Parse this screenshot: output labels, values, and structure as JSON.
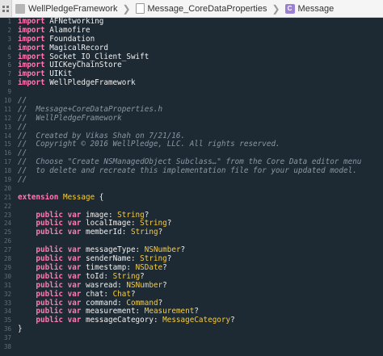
{
  "jumpbar": {
    "items": [
      {
        "label": "WellPledgeFramework",
        "icon": "folder-icon"
      },
      {
        "label": "Message_CoreDataProperties",
        "icon": "swift-file-icon"
      },
      {
        "label": "Message",
        "icon": "class-icon"
      }
    ],
    "class_icon_letter": "C",
    "separator": "❯"
  },
  "colors": {
    "background": "#1e2a33",
    "keyword": "#ff7ab2",
    "comment": "#8a97a3",
    "type": "#f5cc41",
    "plain": "#f0f0f0",
    "line_number": "#5f6e78"
  },
  "code": [
    {
      "n": "1",
      "tokens": [
        {
          "t": "kw",
          "v": "import"
        },
        {
          "t": "plain",
          "v": " AFNetworking"
        }
      ]
    },
    {
      "n": "2",
      "tokens": [
        {
          "t": "kw",
          "v": "import"
        },
        {
          "t": "plain",
          "v": " Alamofire"
        }
      ]
    },
    {
      "n": "3",
      "tokens": [
        {
          "t": "kw",
          "v": "import"
        },
        {
          "t": "plain",
          "v": " Foundation"
        }
      ]
    },
    {
      "n": "4",
      "tokens": [
        {
          "t": "kw",
          "v": "import"
        },
        {
          "t": "plain",
          "v": " MagicalRecord"
        }
      ]
    },
    {
      "n": "5",
      "tokens": [
        {
          "t": "kw",
          "v": "import"
        },
        {
          "t": "plain",
          "v": " Socket_IO_Client_Swift"
        }
      ]
    },
    {
      "n": "6",
      "tokens": [
        {
          "t": "kw",
          "v": "import"
        },
        {
          "t": "plain",
          "v": " UICKeyChainStore"
        }
      ]
    },
    {
      "n": "7",
      "tokens": [
        {
          "t": "kw",
          "v": "import"
        },
        {
          "t": "plain",
          "v": " UIKit"
        }
      ]
    },
    {
      "n": "8",
      "tokens": [
        {
          "t": "kw",
          "v": "import"
        },
        {
          "t": "plain",
          "v": " WellPledgeFramework"
        }
      ]
    },
    {
      "n": "9",
      "tokens": []
    },
    {
      "n": "10",
      "tokens": [
        {
          "t": "cm",
          "v": "//"
        }
      ]
    },
    {
      "n": "11",
      "tokens": [
        {
          "t": "cm",
          "v": "//  Message+CoreDataProperties.h"
        }
      ]
    },
    {
      "n": "12",
      "tokens": [
        {
          "t": "cm",
          "v": "//  WellPledgeFramework"
        }
      ]
    },
    {
      "n": "13",
      "tokens": [
        {
          "t": "cm",
          "v": "//"
        }
      ]
    },
    {
      "n": "14",
      "tokens": [
        {
          "t": "cm",
          "v": "//  Created by Vikas Shah on 7/21/16."
        }
      ]
    },
    {
      "n": "15",
      "tokens": [
        {
          "t": "cm",
          "v": "//  Copyright © 2016 WellPledge, LLC. All rights reserved."
        }
      ]
    },
    {
      "n": "16",
      "tokens": [
        {
          "t": "cm",
          "v": "//"
        }
      ]
    },
    {
      "n": "17",
      "tokens": [
        {
          "t": "cm",
          "v": "//  Choose \"Create NSManagedObject Subclass…\" from the Core Data editor menu"
        }
      ]
    },
    {
      "n": "18",
      "tokens": [
        {
          "t": "cm",
          "v": "//  to delete and recreate this implementation file for your updated model."
        }
      ]
    },
    {
      "n": "19",
      "tokens": [
        {
          "t": "cm",
          "v": "//"
        }
      ]
    },
    {
      "n": "20",
      "tokens": []
    },
    {
      "n": "21",
      "tokens": [
        {
          "t": "kw",
          "v": "extension"
        },
        {
          "t": "plain",
          "v": " "
        },
        {
          "t": "ty",
          "v": "Message"
        },
        {
          "t": "plain",
          "v": " {"
        }
      ]
    },
    {
      "n": "22",
      "tokens": []
    },
    {
      "n": "23",
      "tokens": [
        {
          "t": "plain",
          "v": "    "
        },
        {
          "t": "kw",
          "v": "public"
        },
        {
          "t": "plain",
          "v": " "
        },
        {
          "t": "kw",
          "v": "var"
        },
        {
          "t": "plain",
          "v": " image: "
        },
        {
          "t": "ty",
          "v": "String"
        },
        {
          "t": "plain",
          "v": "?"
        }
      ]
    },
    {
      "n": "24",
      "tokens": [
        {
          "t": "plain",
          "v": "    "
        },
        {
          "t": "kw",
          "v": "public"
        },
        {
          "t": "plain",
          "v": " "
        },
        {
          "t": "kw",
          "v": "var"
        },
        {
          "t": "plain",
          "v": " localImage: "
        },
        {
          "t": "ty",
          "v": "String"
        },
        {
          "t": "plain",
          "v": "?"
        }
      ]
    },
    {
      "n": "25",
      "tokens": [
        {
          "t": "plain",
          "v": "    "
        },
        {
          "t": "kw",
          "v": "public"
        },
        {
          "t": "plain",
          "v": " "
        },
        {
          "t": "kw",
          "v": "var"
        },
        {
          "t": "plain",
          "v": " memberId: "
        },
        {
          "t": "ty",
          "v": "String"
        },
        {
          "t": "plain",
          "v": "?"
        }
      ]
    },
    {
      "n": "26",
      "tokens": []
    },
    {
      "n": "27",
      "tokens": [
        {
          "t": "plain",
          "v": "    "
        },
        {
          "t": "kw",
          "v": "public"
        },
        {
          "t": "plain",
          "v": " "
        },
        {
          "t": "kw",
          "v": "var"
        },
        {
          "t": "plain",
          "v": " messageType: "
        },
        {
          "t": "ty",
          "v": "NSNumber"
        },
        {
          "t": "plain",
          "v": "?"
        }
      ]
    },
    {
      "n": "28",
      "tokens": [
        {
          "t": "plain",
          "v": "    "
        },
        {
          "t": "kw",
          "v": "public"
        },
        {
          "t": "plain",
          "v": " "
        },
        {
          "t": "kw",
          "v": "var"
        },
        {
          "t": "plain",
          "v": " senderName: "
        },
        {
          "t": "ty",
          "v": "String"
        },
        {
          "t": "plain",
          "v": "?"
        }
      ]
    },
    {
      "n": "29",
      "tokens": [
        {
          "t": "plain",
          "v": "    "
        },
        {
          "t": "kw",
          "v": "public"
        },
        {
          "t": "plain",
          "v": " "
        },
        {
          "t": "kw",
          "v": "var"
        },
        {
          "t": "plain",
          "v": " timestamp: "
        },
        {
          "t": "ty",
          "v": "NSDate"
        },
        {
          "t": "plain",
          "v": "?"
        }
      ]
    },
    {
      "n": "30",
      "tokens": [
        {
          "t": "plain",
          "v": "    "
        },
        {
          "t": "kw",
          "v": "public"
        },
        {
          "t": "plain",
          "v": " "
        },
        {
          "t": "kw",
          "v": "var"
        },
        {
          "t": "plain",
          "v": " toId: "
        },
        {
          "t": "ty",
          "v": "String"
        },
        {
          "t": "plain",
          "v": "?"
        }
      ]
    },
    {
      "n": "31",
      "tokens": [
        {
          "t": "plain",
          "v": "    "
        },
        {
          "t": "kw",
          "v": "public"
        },
        {
          "t": "plain",
          "v": " "
        },
        {
          "t": "kw",
          "v": "var"
        },
        {
          "t": "plain",
          "v": " wasread: "
        },
        {
          "t": "ty",
          "v": "NSNumber"
        },
        {
          "t": "plain",
          "v": "?"
        }
      ]
    },
    {
      "n": "32",
      "tokens": [
        {
          "t": "plain",
          "v": "    "
        },
        {
          "t": "kw",
          "v": "public"
        },
        {
          "t": "plain",
          "v": " "
        },
        {
          "t": "kw",
          "v": "var"
        },
        {
          "t": "plain",
          "v": " chat: "
        },
        {
          "t": "ty",
          "v": "Chat"
        },
        {
          "t": "plain",
          "v": "?"
        }
      ]
    },
    {
      "n": "33",
      "tokens": [
        {
          "t": "plain",
          "v": "    "
        },
        {
          "t": "kw",
          "v": "public"
        },
        {
          "t": "plain",
          "v": " "
        },
        {
          "t": "kw",
          "v": "var"
        },
        {
          "t": "plain",
          "v": " command: "
        },
        {
          "t": "ty",
          "v": "Command"
        },
        {
          "t": "plain",
          "v": "?"
        }
      ]
    },
    {
      "n": "34",
      "tokens": [
        {
          "t": "plain",
          "v": "    "
        },
        {
          "t": "kw",
          "v": "public"
        },
        {
          "t": "plain",
          "v": " "
        },
        {
          "t": "kw",
          "v": "var"
        },
        {
          "t": "plain",
          "v": " measurement: "
        },
        {
          "t": "ty",
          "v": "Measurement"
        },
        {
          "t": "plain",
          "v": "?"
        }
      ]
    },
    {
      "n": "35",
      "tokens": [
        {
          "t": "plain",
          "v": "    "
        },
        {
          "t": "kw",
          "v": "public"
        },
        {
          "t": "plain",
          "v": " "
        },
        {
          "t": "kw",
          "v": "var"
        },
        {
          "t": "plain",
          "v": " messageCategory: "
        },
        {
          "t": "ty",
          "v": "MessageCategory"
        },
        {
          "t": "plain",
          "v": "?"
        }
      ]
    },
    {
      "n": "36",
      "tokens": [
        {
          "t": "plain",
          "v": "}"
        }
      ]
    },
    {
      "n": "37",
      "tokens": []
    },
    {
      "n": "38",
      "tokens": []
    }
  ]
}
